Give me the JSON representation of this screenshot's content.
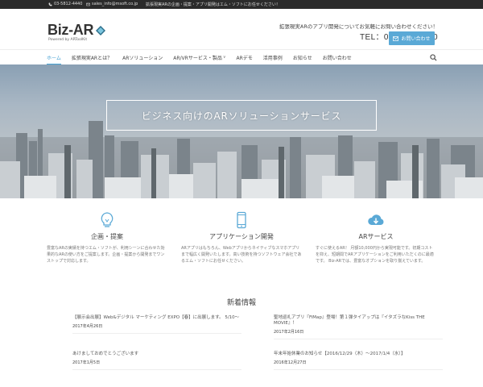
{
  "topbar": {
    "phone": "03-5812-4440",
    "email": "sales_info@msoft.co.jp",
    "tagline": "拡張現実ARの企画・提案・アプリ開発はエム・ソフトにお任せください！"
  },
  "header": {
    "logo_text": "Biz-AR",
    "logo_sub": "Powered by ARToolKit",
    "contact_message": "拡張現実ARのアプリ開発についてお気軽にお問い合わせください！",
    "tel": "TEL：03-5812-4440",
    "inquiry_label": "お問い合わせ"
  },
  "nav": {
    "items": [
      {
        "label": "ホーム"
      },
      {
        "label": "拡張現実ARとは？"
      },
      {
        "label": "ARソリューション"
      },
      {
        "label": "AR/VRサービス・製品"
      },
      {
        "label": "ARデモ"
      },
      {
        "label": "活用事例"
      },
      {
        "label": "お知らせ"
      },
      {
        "label": "お問い合わせ"
      }
    ],
    "caret": "∨"
  },
  "hero": {
    "title": "ビジネス向けのARソリューションサービス"
  },
  "features": [
    {
      "title": "企画・提案",
      "text": "豊富なARの実績を持つエム・ソフトが、利用シーンに合わせた効果的なARの使い方をご提案します。企画・提案から開発までワンストップで対応します。"
    },
    {
      "title": "アプリケーション開発",
      "text": "ARアプリはもちろん、Webアプリからネイティブなスマホアプリまで幅広く開発いたします。高い技術を持つソフトウェア会社であるエム・ソフトにお任せください。"
    },
    {
      "title": "ARサービス",
      "text": "すぐに使えるAR！ 月額10,000円から実現可能です。初期コストを抑え、短期間でARアプリケーションをご利用いただくのに最適です。 Biz-ARでは、豊富なオプションを取り揃えています。"
    }
  ],
  "news": {
    "title": "新着情報",
    "items": [
      {
        "title": "【展示会出展】Web&デジタル マーケティング EXPO【春】に出展します。 5/10〜",
        "date": "2017年4月26日"
      },
      {
        "title": "聖地巡礼アプリ『FiMap』登場！第１弾タイアップは『イタズラなKiss THE MOVIE』！",
        "date": "2017年2月16日"
      },
      {
        "title": "あけましておめでとうございます",
        "date": "2017年1月5日"
      },
      {
        "title": "年末年始休業のお知らせ【2016/12/29（木）〜2017/1/4（水）】",
        "date": "2016年12月27日"
      }
    ]
  },
  "colors": {
    "accent": "#4aa3d4",
    "topbar": "#2b2b2b",
    "button": "#5aa9d6"
  }
}
